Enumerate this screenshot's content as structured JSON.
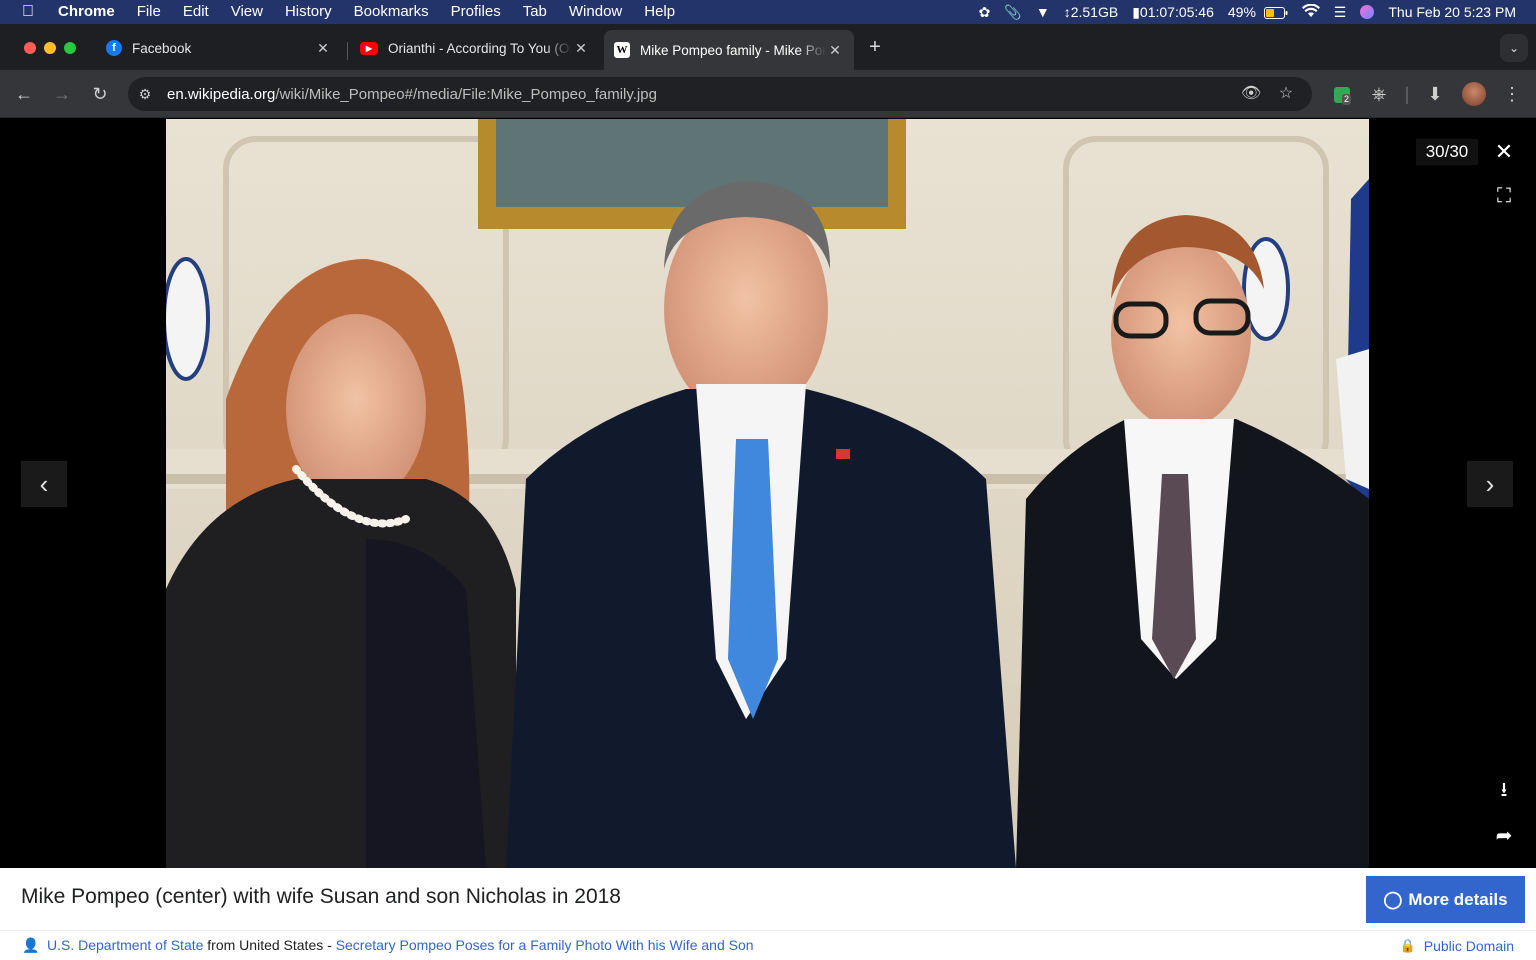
{
  "menubar": {
    "app_name": "Chrome",
    "items": [
      "File",
      "Edit",
      "View",
      "History",
      "Bookmarks",
      "Profiles",
      "Tab",
      "Window",
      "Help"
    ],
    "memory": "2.51GB",
    "timer": "01:07:05:46",
    "battery": "49%",
    "datetime": "Thu Feb 20  5:23 PM"
  },
  "tabs": [
    {
      "title": "Facebook",
      "favicon": "facebook-icon",
      "favicon_color": "#1877f2"
    },
    {
      "title": "Orianthi - According To You (Official Video)",
      "favicon": "youtube-icon",
      "favicon_color": "#ff0000"
    },
    {
      "title": "Mike Pompeo family - Mike Pompeo - Wikipedia",
      "favicon": "wikipedia-icon",
      "favicon_color": "#ffffff",
      "active": true
    }
  ],
  "toolbar": {
    "url_host": "en.wikipedia.org",
    "url_path": "/wiki/Mike_Pompeo#/media/File:Mike_Pompeo_family.jpg",
    "extension_badge": "2"
  },
  "viewer": {
    "counter": "30/30",
    "image_subject": "Mike Pompeo family photo"
  },
  "caption": {
    "text": "Mike Pompeo (center) with wife Susan and son Nicholas in 2018",
    "more_details_label": "More details"
  },
  "attribution": {
    "author": "U.S. Department of State",
    "from": " from United States - ",
    "source_title": "Secretary Pompeo Poses for a Family Photo With his Wife and Son",
    "license": "Public Domain"
  },
  "colors": {
    "menubar": "#23346b",
    "accent_button": "#3366cc",
    "link": "#3366cc"
  }
}
